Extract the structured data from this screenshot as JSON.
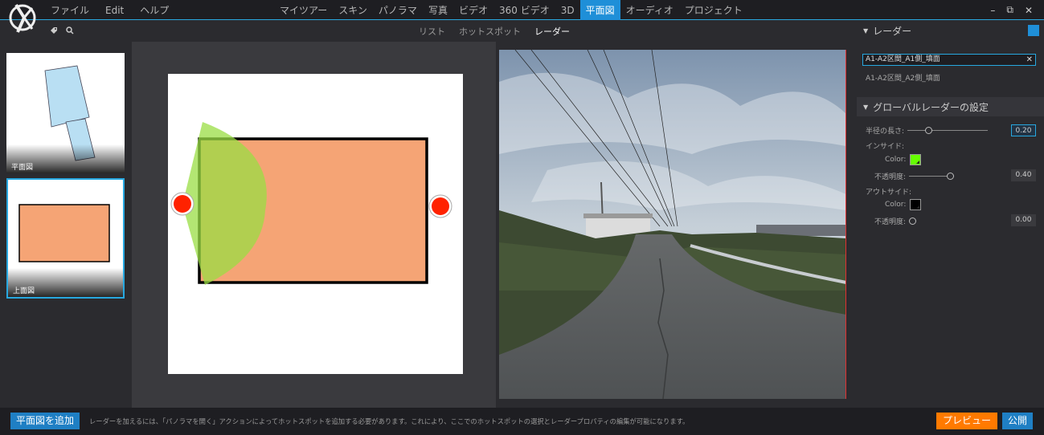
{
  "menu": {
    "left": [
      "ファイル",
      "Edit",
      "ヘルプ"
    ],
    "center": [
      "マイツアー",
      "スキン",
      "パノラマ",
      "写真",
      "ビデオ",
      "360 ビデオ",
      "3D",
      "平面図",
      "オーディオ",
      "プロジェクト"
    ],
    "active": "平面図"
  },
  "window_controls": {
    "minimize": "–",
    "restore": "⧉",
    "close": "✕"
  },
  "subtabs": {
    "list": "リスト",
    "hotspot": "ホットスポット",
    "radar": "レーダー"
  },
  "thumbnails": [
    {
      "label": "平面図"
    },
    {
      "label": "上面図"
    }
  ],
  "right_panel": {
    "radar_header": "レーダー",
    "search_value": "A1-A2区間_A1側_填面",
    "list_item": "A1-A2区間_A2側_填面",
    "global_header": "グローバルレーダーの設定",
    "radius_label": "半径の長さ:",
    "radius_value": "0.20",
    "radius_fraction": 0.12,
    "inside_label": "インサイド:",
    "inside_color_label": "Color:",
    "inside_color": "#66ff00",
    "inside_opacity_label": "不透明度:",
    "inside_opacity_value": "0.40",
    "outside_label": "アウトサイド:",
    "outside_color_label": "Color:",
    "outside_color": "#000000",
    "outside_opacity_label": "不透明度:",
    "outside_opacity_value": "0.00"
  },
  "bottom": {
    "add_button": "平面図を追加",
    "hint": "レーダーを加えるには、「パノラマを開く」アクションによってホットスポットを追加する必要があります。これにより、ここでのホットスポットの選択とレーダープロパティの編集が可能になります。",
    "preview_button": "プレビュー",
    "publish_button": "公開"
  },
  "colors": {
    "accent": "#1f8fd8",
    "preview": "#ff7a00",
    "hotspot": "#ff2200",
    "room_fill": "#f5a475",
    "radar_fill": "#a6e04a"
  }
}
